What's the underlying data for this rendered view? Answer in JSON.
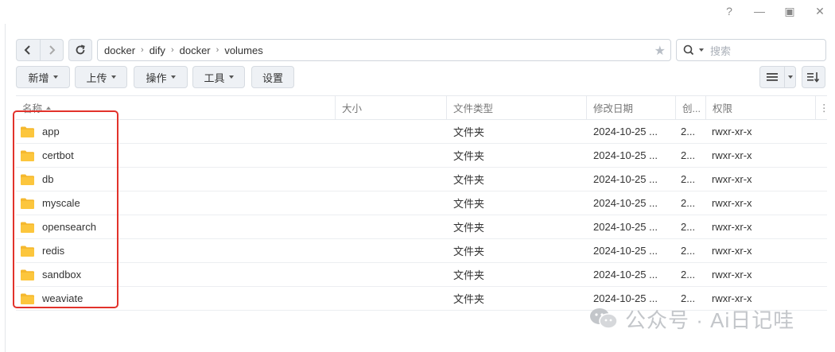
{
  "window": {
    "help": "?",
    "minimize": "—",
    "maximize": "▣",
    "close": "✕"
  },
  "path": {
    "crumbs": [
      "docker",
      "dify",
      "docker",
      "volumes"
    ]
  },
  "search": {
    "placeholder": "搜索"
  },
  "toolbar": {
    "new": "新增",
    "upload": "上传",
    "action": "操作",
    "tools": "工具",
    "settings": "设置"
  },
  "table": {
    "headers": {
      "name": "名称",
      "size": "大小",
      "type": "文件类型",
      "modified": "修改日期",
      "created": "创...",
      "perm": "权限"
    },
    "rows": [
      {
        "name": "app",
        "size": "",
        "type": "文件夹",
        "modified": "2024-10-25 ...",
        "created": "2...",
        "perm": "rwxr-xr-x"
      },
      {
        "name": "certbot",
        "size": "",
        "type": "文件夹",
        "modified": "2024-10-25 ...",
        "created": "2...",
        "perm": "rwxr-xr-x"
      },
      {
        "name": "db",
        "size": "",
        "type": "文件夹",
        "modified": "2024-10-25 ...",
        "created": "2...",
        "perm": "rwxr-xr-x"
      },
      {
        "name": "myscale",
        "size": "",
        "type": "文件夹",
        "modified": "2024-10-25 ...",
        "created": "2...",
        "perm": "rwxr-xr-x"
      },
      {
        "name": "opensearch",
        "size": "",
        "type": "文件夹",
        "modified": "2024-10-25 ...",
        "created": "2...",
        "perm": "rwxr-xr-x"
      },
      {
        "name": "redis",
        "size": "",
        "type": "文件夹",
        "modified": "2024-10-25 ...",
        "created": "2...",
        "perm": "rwxr-xr-x"
      },
      {
        "name": "sandbox",
        "size": "",
        "type": "文件夹",
        "modified": "2024-10-25 ...",
        "created": "2...",
        "perm": "rwxr-xr-x"
      },
      {
        "name": "weaviate",
        "size": "",
        "type": "文件夹",
        "modified": "2024-10-25 ...",
        "created": "2...",
        "perm": "rwxr-xr-x"
      }
    ]
  },
  "watermark": {
    "text": "公众号 · Ai日记哇"
  },
  "colors": {
    "folder": "#f5b82e",
    "highlight": "#e2322b",
    "button_bg": "#eef1f5"
  },
  "icons": {
    "folder": "folder-icon",
    "back": "chevron-left-icon",
    "forward": "chevron-right-icon",
    "refresh": "refresh-icon",
    "star": "star-icon",
    "search": "search-icon",
    "list": "list-view-icon",
    "sort": "sort-icon"
  }
}
